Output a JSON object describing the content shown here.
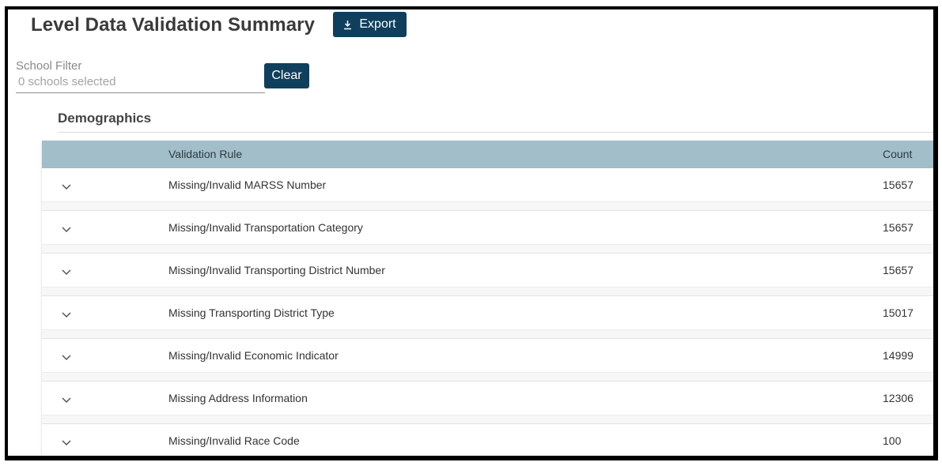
{
  "header": {
    "title": "Level Data Validation Summary",
    "export_label": "Export",
    "export_icon": "download-icon"
  },
  "filter": {
    "label": "School Filter",
    "value": "0 schools selected",
    "clear_label": "Clear"
  },
  "section": {
    "title": "Demographics"
  },
  "table": {
    "columns": [
      "Validation Rule",
      "Count"
    ],
    "rows": [
      {
        "rule": "Missing/Invalid MARSS Number",
        "count": "15657"
      },
      {
        "rule": "Missing/Invalid Transportation Category",
        "count": "15657"
      },
      {
        "rule": "Missing/Invalid Transporting District Number",
        "count": "15657"
      },
      {
        "rule": "Missing Transporting District Type",
        "count": "15017"
      },
      {
        "rule": "Missing/Invalid Economic Indicator",
        "count": "14999"
      },
      {
        "rule": "Missing Address Information",
        "count": "12306"
      },
      {
        "rule": "Missing/Invalid Race Code",
        "count": "100"
      }
    ]
  },
  "colors": {
    "button_bg": "#0f3f5c",
    "table_header_bg": "#a1bec9",
    "frame_border": "#000000"
  }
}
